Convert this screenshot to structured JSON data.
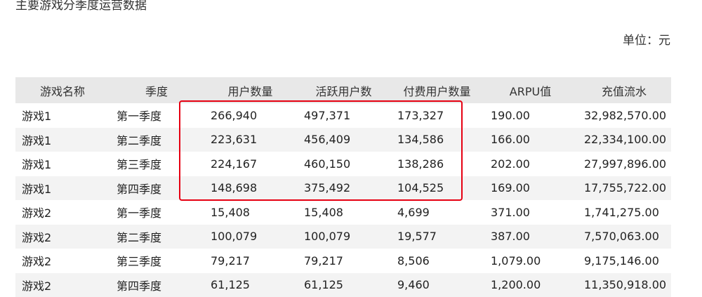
{
  "title": "主要游戏分季度运营数据",
  "unit": "单位：元",
  "table": {
    "headers": [
      "游戏名称",
      "季度",
      "用户数量",
      "活跃用户数",
      "付费用户数量",
      "ARPU值",
      "充值流水"
    ],
    "rows": [
      [
        "游戏1",
        "第一季度",
        "266,940",
        "497,371",
        "173,327",
        "190.00",
        "32,982,570.00"
      ],
      [
        "游戏1",
        "第二季度",
        "223,631",
        "456,409",
        "134,586",
        "166.00",
        "22,334,100.00"
      ],
      [
        "游戏1",
        "第三季度",
        "224,167",
        "460,150",
        "138,286",
        "202.00",
        "27,997,896.00"
      ],
      [
        "游戏1",
        "第四季度",
        "148,698",
        "375,492",
        "104,525",
        "169.00",
        "17,755,722.00"
      ],
      [
        "游戏2",
        "第一季度",
        "15,408",
        "15,408",
        "4,699",
        "371.00",
        "1,741,275.00"
      ],
      [
        "游戏2",
        "第二季度",
        "100,079",
        "100,079",
        "19,577",
        "387.00",
        "7,570,063.00"
      ],
      [
        "游戏2",
        "第三季度",
        "79,217",
        "79,217",
        "8,506",
        "1,079.00",
        "9,175,146.00"
      ],
      [
        "游戏2",
        "第四季度",
        "61,125",
        "61,125",
        "9,460",
        "1,200.00",
        "11,350,918.00"
      ]
    ]
  },
  "colors": {
    "header_bg": "#e8e8e8",
    "stripe_bg": "#f3f3f3",
    "highlight_border": "#e60012"
  }
}
